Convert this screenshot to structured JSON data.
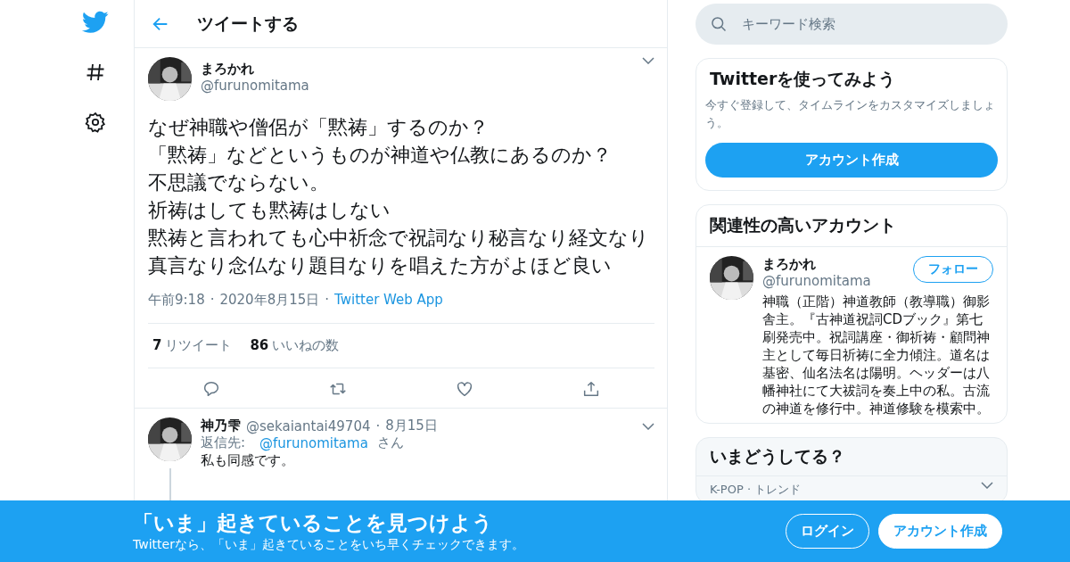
{
  "nav": {
    "items": [
      {
        "kind": "logo"
      },
      {
        "kind": "hashtag"
      },
      {
        "kind": "settings"
      }
    ]
  },
  "header": {
    "title": "ツイートする"
  },
  "tweet": {
    "author": {
      "name": "まろかれ",
      "handle": "@furunomitama"
    },
    "lines": [
      "なぜ神職や僧侶が「黙祷」するのか？",
      "「黙祷」などというものが神道や仏教にあるのか？",
      "不思議でならない。",
      "祈祷はしても黙祷はしない",
      "黙祷と言われても心中祈念で祝詞なり秘言なり経文なり真言なり念仏なり題目なりを唱えた方がよほど良い"
    ],
    "time": "午前9:18",
    "separator": "·",
    "date": "2020年8月15日",
    "source": "Twitter Web App",
    "stats": [
      {
        "count": "7",
        "label": "リツイート"
      },
      {
        "count": "86",
        "label": "いいねの数"
      }
    ],
    "actions": [
      {
        "kind": "reply"
      },
      {
        "kind": "retweet"
      },
      {
        "kind": "like"
      },
      {
        "kind": "share"
      }
    ]
  },
  "reply": {
    "author": {
      "name": "神乃雫",
      "handle": "@sekaiantai49704"
    },
    "separator": "·",
    "date": "8月15日",
    "reply_to_label": "返信先:",
    "reply_to": "@furunomitama",
    "reply_to_suffix": "さん",
    "paragraphs": [
      "私も同感です。"
    ]
  },
  "search": {
    "placeholder": "キーワード検索"
  },
  "signup_card": {
    "title": "Twitterを使ってみよう",
    "text": "今すぐ登録して、タイムラインをカスタマイズしましょう。",
    "button": "アカウント作成"
  },
  "related_card": {
    "title": "関連性の高いアカウント",
    "account": {
      "name": "まろかれ",
      "handle": "@furunomitama",
      "follow": "フォロー",
      "bio": "神職（正階）神道教師（教導職）御影舎主。『古神道祝詞CDブック』第七刷発売中。祝詞講座・御祈祷・顧問神主として毎日祈祷に全力傾注。道名は基密、仙名法名は陽明。ヘッダーは八幡神社にて大祓詞を奏上中の私。古流の神道を修行中。神道修験を模索中。"
    }
  },
  "trends_card": {
    "title": "いまどうしてる？",
    "items": [
      {
        "context": "K-POP · トレンド"
      }
    ]
  },
  "bottom_bar": {
    "title": "「いま」起きていることを見つけよう",
    "subtitle": "Twitterなら、「いま」起きていることをいち早くチェックできます。",
    "login": "ログイン",
    "signup": "アカウント作成"
  }
}
